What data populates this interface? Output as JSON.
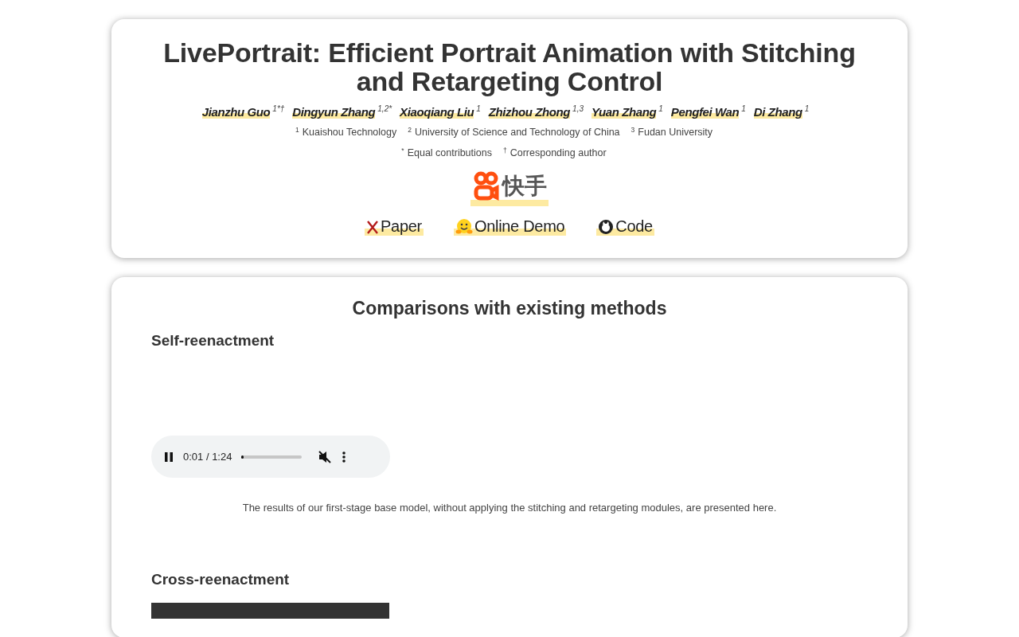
{
  "header": {
    "title": "LivePortrait: Efficient Portrait Animation with Stitching and Retargeting Control",
    "authors": [
      {
        "name": "Jianzhu Guo",
        "marks": "1*†"
      },
      {
        "name": "Dingyun Zhang",
        "marks": "1,2*"
      },
      {
        "name": "Xiaoqiang Liu",
        "marks": "1"
      },
      {
        "name": "Zhizhou Zhong",
        "marks": "1,3"
      },
      {
        "name": "Yuan Zhang",
        "marks": "1"
      },
      {
        "name": "Pengfei Wan",
        "marks": "1"
      },
      {
        "name": "Di Zhang",
        "marks": "1"
      }
    ],
    "affiliations": [
      {
        "mark": "1",
        "name": "Kuaishou Technology"
      },
      {
        "mark": "2",
        "name": "University of Science and Technology of China"
      },
      {
        "mark": "3",
        "name": "Fudan University"
      }
    ],
    "notes": [
      {
        "mark": "*",
        "text": "Equal contributions"
      },
      {
        "mark": "†",
        "text": "Corresponding author"
      }
    ],
    "logo_text": "快手",
    "links": [
      {
        "kind": "paper",
        "label": "Paper"
      },
      {
        "kind": "demo",
        "label": "Online Demo"
      },
      {
        "kind": "code",
        "label": "Code"
      }
    ]
  },
  "comparisons": {
    "title": "Comparisons with existing methods",
    "sections": [
      {
        "kind": "audio",
        "heading": "Self-reenactment",
        "player": {
          "time": "0:01 / 1:24",
          "level": 0.03,
          "playing": true,
          "muted": true
        },
        "caption": "The results of our first-stage base model, without applying the stitching and retargeting modules, are presented here."
      },
      {
        "kind": "video",
        "heading": "Cross-reenactment"
      }
    ]
  }
}
